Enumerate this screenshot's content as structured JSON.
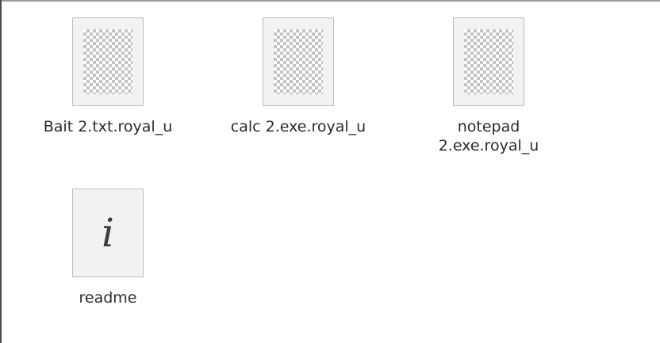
{
  "files": [
    {
      "name": "Bait 2.txt.royal_u",
      "icon": "broken-thumbnail-icon"
    },
    {
      "name": "calc 2.exe.royal_u",
      "icon": "broken-thumbnail-icon"
    },
    {
      "name": "notepad\n2.exe.royal_u",
      "icon": "broken-thumbnail-icon"
    },
    {
      "name": "readme",
      "icon": "info-document-icon",
      "glyph": "i"
    }
  ]
}
